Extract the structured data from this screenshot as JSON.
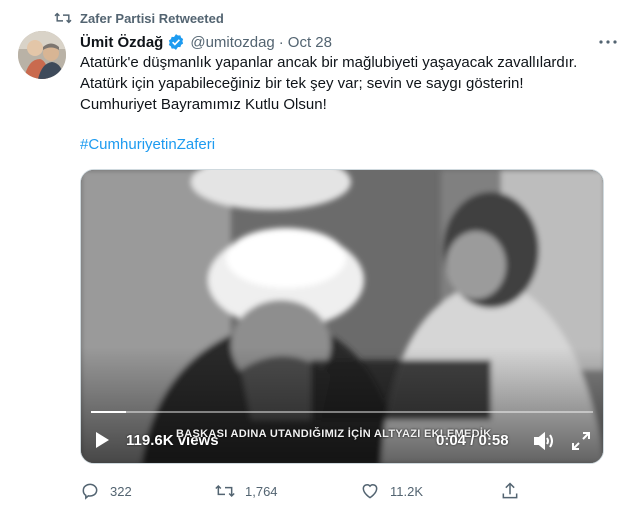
{
  "retweet": {
    "label": "Zafer Partisi Retweeted"
  },
  "author": {
    "name": "Ümit Özdağ",
    "handle": "@umitozdag",
    "separator": "·",
    "date": "Oct 28",
    "verified_color": "#1d9bf0"
  },
  "tweet": {
    "lines": [
      "Atatürk'e düşmanlık yapanlar ancak bir mağlubiyeti yaşayacak zavallılardır.",
      "Atatürk için yapabileceğiniz bir tek şey var; sevin ve saygı gösterin!",
      "Cumhuriyet Bayramımız Kutlu Olsun!"
    ],
    "hashtag": "#CumhuriyetinZaferi"
  },
  "video": {
    "views": "119.6K views",
    "subtitle": "BAŞKASI ADINA UTANDIĞIMIZ İÇİN ALTYAZI EKLEMEDİK",
    "time": "0:04 / 0:58",
    "progress_fraction": 0.07
  },
  "actions": {
    "replies": "322",
    "retweets": "1,764",
    "likes": "11.2K"
  },
  "colors": {
    "muted": "#536471",
    "accent": "#1d9bf0",
    "text": "#0f1419"
  },
  "icons": [
    "retweet-icon",
    "verified-icon",
    "more-icon",
    "play-icon",
    "volume-icon",
    "fullscreen-icon",
    "reply-icon",
    "like-icon",
    "share-icon"
  ]
}
